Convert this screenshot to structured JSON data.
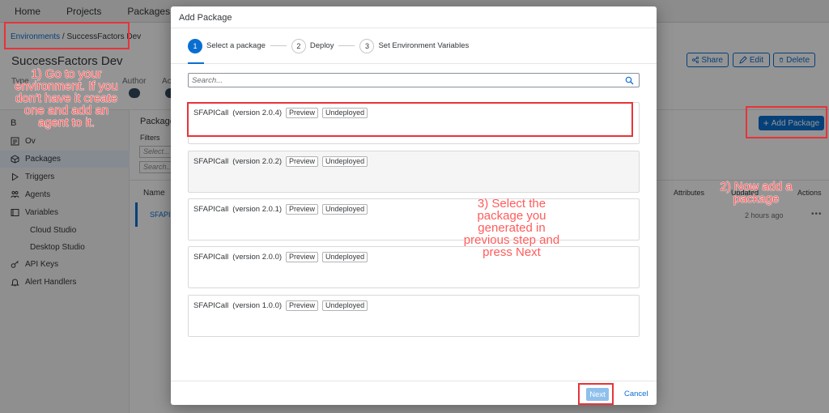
{
  "topnav": {
    "items": [
      "Home",
      "Projects",
      "Packages"
    ]
  },
  "breadcrumb": {
    "link": "Environments",
    "separator": " / ",
    "current": "SuccessFactors Dev"
  },
  "environment": {
    "title": "SuccessFactors Dev",
    "type_label": "Type",
    "author_label": "Author",
    "ac_label": "Ac"
  },
  "header_actions": {
    "share": "Share",
    "edit": "Edit",
    "delete": "Delete"
  },
  "sidebar": {
    "heading": "B",
    "items": [
      {
        "label": "Ov",
        "icon": "overview-icon"
      },
      {
        "label": "Packages",
        "icon": "package-icon"
      },
      {
        "label": "Triggers",
        "icon": "play-icon"
      },
      {
        "label": "Agents",
        "icon": "agents-icon"
      },
      {
        "label": "Variables",
        "icon": "variables-icon"
      },
      {
        "label": "Cloud Studio",
        "icon": ""
      },
      {
        "label": "Desktop Studio",
        "icon": ""
      },
      {
        "label": "API Keys",
        "icon": "key-icon"
      },
      {
        "label": "Alert Handlers",
        "icon": "bell-icon"
      }
    ]
  },
  "content": {
    "title": "Package",
    "filters_label": "Filters",
    "filter1_placeholder": "Select...",
    "filter2_placeholder": "Search...",
    "add_package_label": "Add Package",
    "columns": {
      "name": "Name",
      "attributes": "Attributes",
      "updated": "Updated",
      "actions": "Actions"
    },
    "row": {
      "name": "SFAPI",
      "updated": "2 hours ago"
    }
  },
  "dialog": {
    "title": "Add Package",
    "steps": [
      {
        "num": "1",
        "label": "Select a package"
      },
      {
        "num": "2",
        "label": "Deploy"
      },
      {
        "num": "3",
        "label": "Set Environment Variables"
      }
    ],
    "search_placeholder": "Search...",
    "packages": [
      {
        "name": "SFAPICall",
        "version": "(version 2.0.4)",
        "tag1": "Preview",
        "tag2": "Undeployed"
      },
      {
        "name": "SFAPICall",
        "version": "(version 2.0.2)",
        "tag1": "Preview",
        "tag2": "Undeployed"
      },
      {
        "name": "SFAPICall",
        "version": "(version 2.0.1)",
        "tag1": "Preview",
        "tag2": "Undeployed"
      },
      {
        "name": "SFAPICall",
        "version": "(version 2.0.0)",
        "tag1": "Preview",
        "tag2": "Undeployed"
      },
      {
        "name": "SFAPICall",
        "version": "(version 1.0.0)",
        "tag1": "Preview",
        "tag2": "Undeployed"
      }
    ],
    "next_label": "Next",
    "cancel_label": "Cancel"
  },
  "annotations": {
    "step1": "1) Go to your\nenvironment. If you\ndon't have it create\none and add an\nagent to it.",
    "step2": "2) Now add a\npackage",
    "step3": "3) Select the\npackage you\ngenerated in\nprevious step and\npress Next"
  },
  "colors": {
    "accent": "#0a6ed1",
    "annotation": "#e8333a",
    "next_disabled": "#8fc0ec"
  }
}
